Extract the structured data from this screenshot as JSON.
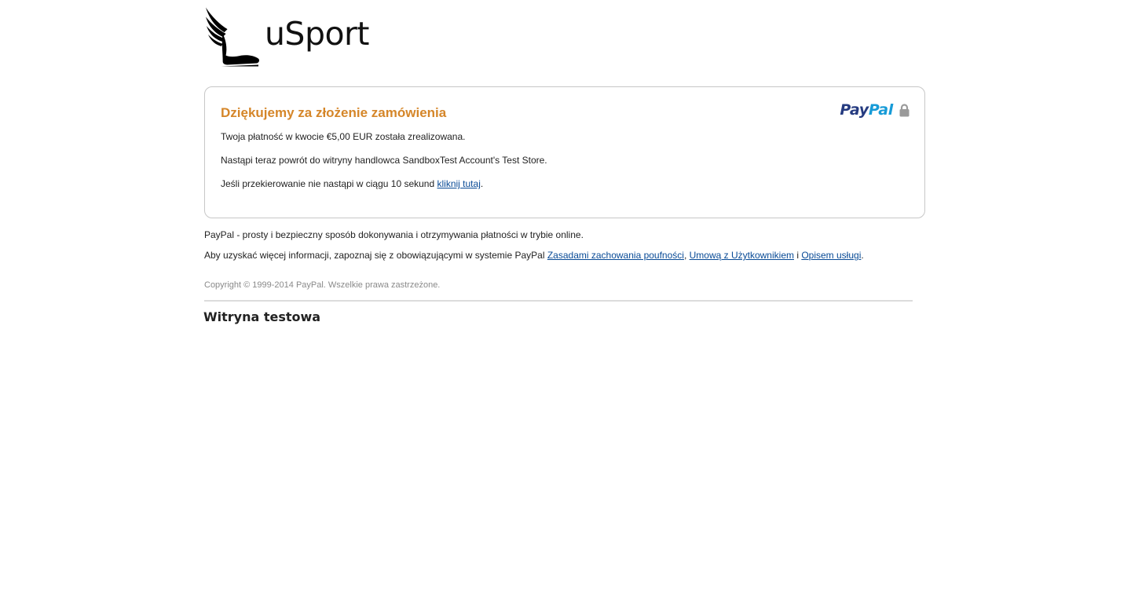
{
  "brand": {
    "logo_text": "uSport",
    "logo_icon": "winged-shoe-icon"
  },
  "card": {
    "title": "Dziękujemy za złożenie zamówienia",
    "paypal_logo_part1": "Pay",
    "paypal_logo_part2": "Pal",
    "lock_icon": "lock-icon",
    "payment_text": "Twoja płatność w kwocie €5,00 EUR została zrealizowana.",
    "return_text": "Nastąpi teraz powrót do witryny handlowca SandboxTest Account's Test Store.",
    "redirect_text": "Jeśli przekierowanie nie nastąpi w ciągu 10 sekund ",
    "redirect_link": "kliknij tutaj",
    "redirect_suffix": "."
  },
  "info": {
    "tagline": "PayPal - prosty i bezpieczny sposób dokonywania i otrzymywania płatności w trybie online.",
    "more_prefix": "Aby uzyskać więcej informacji, zapoznaj się z obowiązującymi w systemie PayPal ",
    "privacy_link": "Zasadami zachowania poufności",
    "sep1": ", ",
    "user_agreement_link": "Umową z Użytkownikiem",
    "sep2": " i ",
    "service_link": "Opisem usługi",
    "end": "."
  },
  "footer": {
    "copyright": "Copyright © 1999-2014 PayPal. Wszelkie prawa zastrzeżone.",
    "test_site": "Witryna testowa"
  },
  "colors": {
    "title_orange": "#d58629",
    "paypal_dark_blue": "#253b80",
    "paypal_light_blue": "#179bd7",
    "link_blue": "#084a96"
  }
}
